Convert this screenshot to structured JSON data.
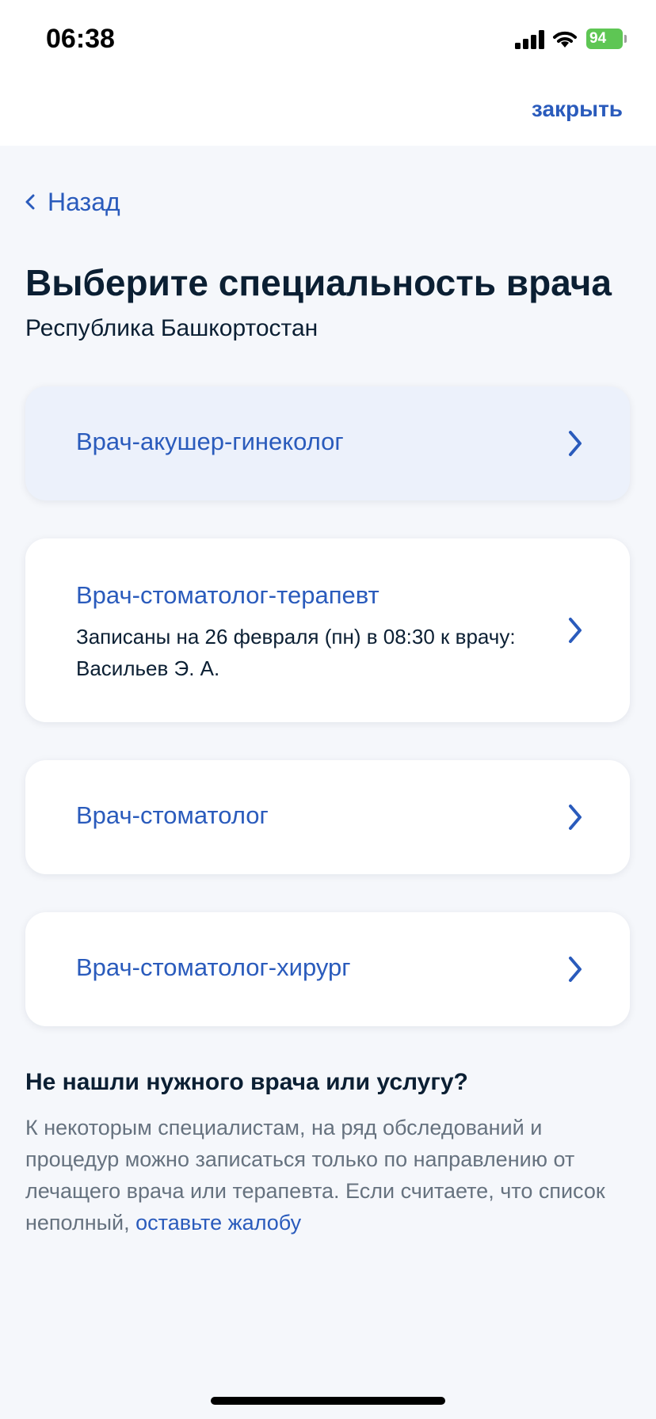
{
  "status_bar": {
    "time": "06:38",
    "battery": "94"
  },
  "header": {
    "close_label": "закрыть"
  },
  "nav": {
    "back_label": "Назад"
  },
  "page": {
    "title": "Выберите специальность врача",
    "region": "Республика Башкортостан"
  },
  "specialties": [
    {
      "name": "Врач-акушер-гинеколог"
    },
    {
      "name": "Врач-стоматолог-терапевт",
      "note": "Записаны на 26 февраля (пн) в 08:30 к врачу: Васильев Э. А."
    },
    {
      "name": "Врач-стоматолог"
    },
    {
      "name": "Врач-стоматолог-хирург"
    }
  ],
  "help": {
    "title": "Не нашли нужного врача или услугу?",
    "text": "К некоторым специалистам, на ряд обследований и процедур можно записаться только по направлению от лечащего врача или терапевта. Если считаете, что список неполный, ",
    "link": "оставьте жалобу"
  },
  "colors": {
    "accent": "#2a5bbc",
    "background": "#f5f7fb",
    "card": "#ffffff",
    "card_active": "#ecf1fb",
    "text": "#0b1f33",
    "muted": "#66727f",
    "battery": "#5ec654"
  },
  "icons": {
    "back": "chevron-left-icon",
    "card": "chevron-right-icon",
    "signal": "cellular-signal-icon",
    "wifi": "wifi-icon",
    "battery": "battery-charging-icon"
  }
}
